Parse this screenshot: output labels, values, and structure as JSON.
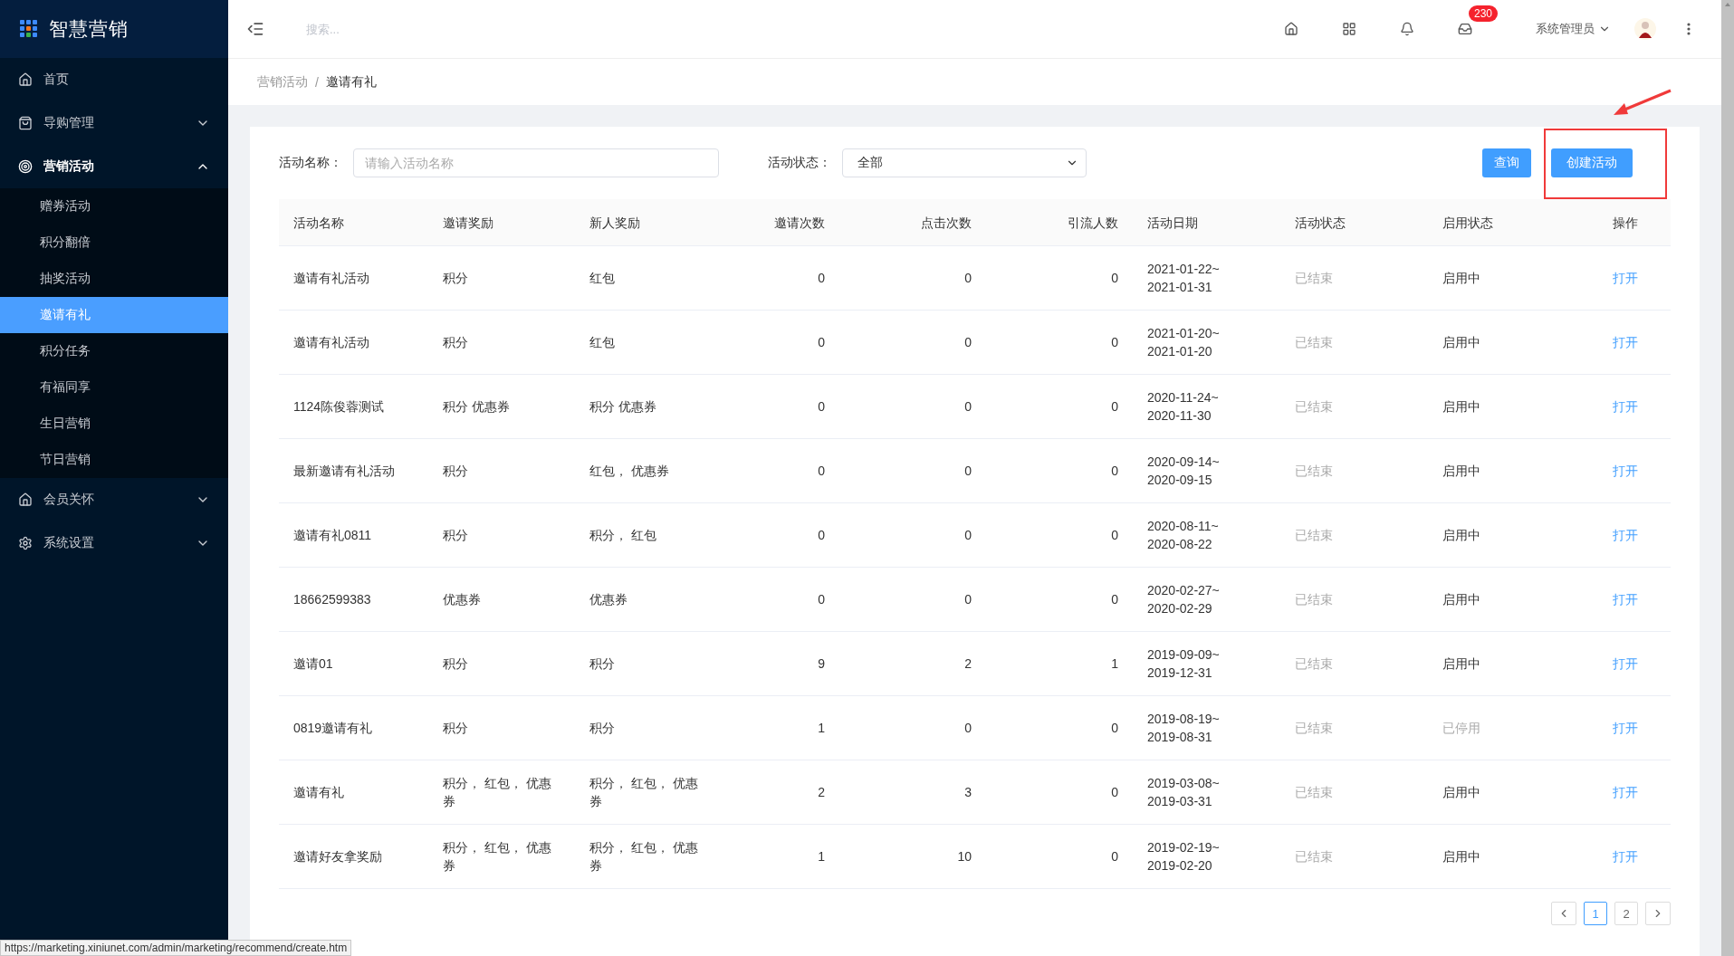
{
  "sidebar": {
    "logo": "智慧营销",
    "items": [
      {
        "label": "首页"
      },
      {
        "label": "导购管理",
        "expanded": false
      },
      {
        "label": "营销活动",
        "expanded": true,
        "children": [
          {
            "label": "赠券活动",
            "selected": false
          },
          {
            "label": "积分翻倍",
            "selected": false
          },
          {
            "label": "抽奖活动",
            "selected": false
          },
          {
            "label": "邀请有礼",
            "selected": true
          },
          {
            "label": "积分任务",
            "selected": false
          },
          {
            "label": "有福同享",
            "selected": false
          },
          {
            "label": "生日营销",
            "selected": false
          },
          {
            "label": "节日营销",
            "selected": false
          }
        ]
      },
      {
        "label": "会员关怀",
        "expanded": false
      },
      {
        "label": "系统设置",
        "expanded": false
      }
    ]
  },
  "topbar": {
    "search": {
      "placeholder": "搜索..."
    },
    "badge": "230",
    "user": "系统管理员"
  },
  "breadcrumb": {
    "items": [
      "营销活动",
      "邀请有礼"
    ],
    "separator": "/"
  },
  "filters": [
    {
      "label": "活动名称：",
      "kind": "input",
      "placeholder": "请输入活动名称"
    },
    {
      "label": "活动状态：",
      "kind": "select",
      "value": "全部"
    }
  ],
  "buttons": [
    "查询",
    "创建活动"
  ],
  "table": {
    "columns": [
      "活动名称",
      "邀请奖励",
      "新人奖励",
      "邀请次数",
      "点击次数",
      "引流人数",
      "活动日期",
      "活动状态",
      "启用状态",
      "操作"
    ],
    "rows": [
      {
        "name": "邀请有礼活动",
        "invite_reward": "积分",
        "new_reward": "红包",
        "invites": "0",
        "clicks": "0",
        "traffic": "0",
        "date": [
          "2021-01-22~",
          "2021-01-31"
        ],
        "status": "已结束",
        "enable_state": "启用中",
        "enabled": true,
        "action": "打开"
      },
      {
        "name": "邀请有礼活动",
        "invite_reward": "积分",
        "new_reward": "红包",
        "invites": "0",
        "clicks": "0",
        "traffic": "0",
        "date": [
          "2021-01-20~",
          "2021-01-20"
        ],
        "status": "已结束",
        "enable_state": "启用中",
        "enabled": true,
        "action": "打开"
      },
      {
        "name": "1124陈俊蓉测试",
        "invite_reward": "积分 优惠券",
        "new_reward": "积分 优惠券",
        "invites": "0",
        "clicks": "0",
        "traffic": "0",
        "date": [
          "2020-11-24~",
          "2020-11-30"
        ],
        "status": "已结束",
        "enable_state": "启用中",
        "enabled": true,
        "action": "打开"
      },
      {
        "name": "最新邀请有礼活动",
        "invite_reward": "积分",
        "new_reward": "红包， 优惠券",
        "invites": "0",
        "clicks": "0",
        "traffic": "0",
        "date": [
          "2020-09-14~",
          "2020-09-15"
        ],
        "status": "已结束",
        "enable_state": "启用中",
        "enabled": true,
        "action": "打开"
      },
      {
        "name": "邀请有礼0811",
        "invite_reward": "积分",
        "new_reward": "积分， 红包",
        "invites": "0",
        "clicks": "0",
        "traffic": "0",
        "date": [
          "2020-08-11~",
          "2020-08-22"
        ],
        "status": "已结束",
        "enable_state": "启用中",
        "enabled": true,
        "action": "打开"
      },
      {
        "name": "18662599383",
        "invite_reward": "优惠券",
        "new_reward": "优惠券",
        "invites": "0",
        "clicks": "0",
        "traffic": "0",
        "date": [
          "2020-02-27~",
          "2020-02-29"
        ],
        "status": "已结束",
        "enable_state": "启用中",
        "enabled": true,
        "action": "打开"
      },
      {
        "name": "邀请01",
        "invite_reward": "积分",
        "new_reward": "积分",
        "invites": "9",
        "clicks": "2",
        "traffic": "1",
        "date": [
          "2019-09-09~",
          "2019-12-31"
        ],
        "status": "已结束",
        "enable_state": "启用中",
        "enabled": true,
        "action": "打开"
      },
      {
        "name": "0819邀请有礼",
        "invite_reward": "积分",
        "new_reward": "积分",
        "invites": "1",
        "clicks": "0",
        "traffic": "0",
        "date": [
          "2019-08-19~",
          "2019-08-31"
        ],
        "status": "已结束",
        "enable_state": "已停用",
        "enabled": false,
        "action": "打开"
      },
      {
        "name": "邀请有礼",
        "invite_reward": "积分， 红包， 优惠券",
        "new_reward": "积分， 红包， 优惠券",
        "invites": "2",
        "clicks": "3",
        "traffic": "0",
        "date": [
          "2019-03-08~",
          "2019-03-31"
        ],
        "status": "已结束",
        "enable_state": "启用中",
        "enabled": true,
        "action": "打开"
      },
      {
        "name": "邀请好友拿奖励",
        "invite_reward": "积分， 红包， 优惠券",
        "new_reward": "积分， 红包， 优惠券",
        "invites": "1",
        "clicks": "10",
        "traffic": "0",
        "date": [
          "2019-02-19~",
          "2019-02-20"
        ],
        "status": "已结束",
        "enable_state": "启用中",
        "enabled": true,
        "action": "打开"
      }
    ]
  },
  "pagination": [
    {
      "label": "1",
      "selected": true
    },
    {
      "label": "2",
      "selected": false
    }
  ],
  "status_url": "https://marketing.xiniunet.com/admin/marketing/recommend/create.htm"
}
